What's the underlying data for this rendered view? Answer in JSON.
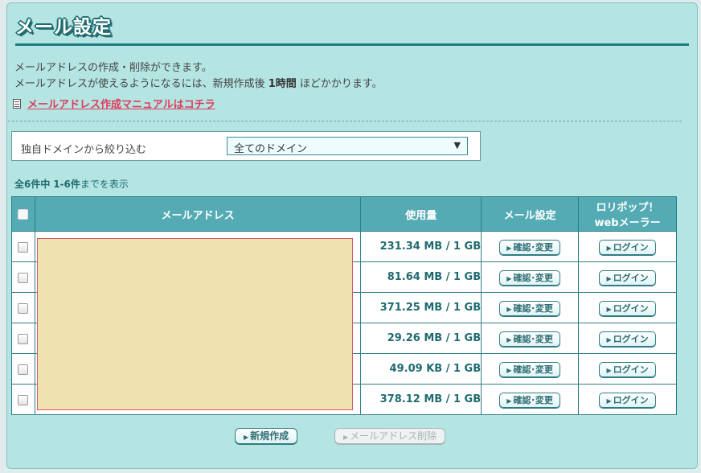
{
  "page": {
    "title": "メール設定",
    "desc_line1": "メールアドレスの作成・削除ができます。",
    "desc_line2_pre": "メールアドレスが使えるようになるには、新規作成後 ",
    "desc_line2_bold": "1時間",
    "desc_line2_post": " ほどかかります。",
    "manual_link": "メールアドレス作成マニュアルはコチラ"
  },
  "filter": {
    "label": "独自ドメインから絞り込む",
    "selected": "全てのドメイン"
  },
  "count": {
    "bold1": "全6件中",
    "bold2": "1-6件",
    "suffix": "までを表示"
  },
  "table": {
    "headers": {
      "address": "メールアドレス",
      "usage": "使用量",
      "mail_settings": "メール設定",
      "webmailer_line1": "ロリポップ！",
      "webmailer_line2": "webメーラー"
    },
    "confirm_label": "確認･変更",
    "login_label": "ログイン",
    "rows": [
      {
        "usage": "231.34 MB / 1 GB"
      },
      {
        "usage": "81.64 MB / 1 GB"
      },
      {
        "usage": "371.25 MB / 1 GB"
      },
      {
        "usage": "29.26 MB / 1 GB"
      },
      {
        "usage": "49.09 KB / 1 GB"
      },
      {
        "usage": "378.12 MB / 1 GB"
      }
    ]
  },
  "buttons": {
    "new": "新規作成",
    "delete": "メールアドレス削除"
  },
  "colors": {
    "panel_bg": "#b4e5e3",
    "header_bg": "#55abb4",
    "accent": "#1f7a80",
    "link": "#e03a5a"
  },
  "icons": [
    "document-icon",
    "dropdown-arrow-icon",
    "triangle-right-icon",
    "checkbox"
  ]
}
